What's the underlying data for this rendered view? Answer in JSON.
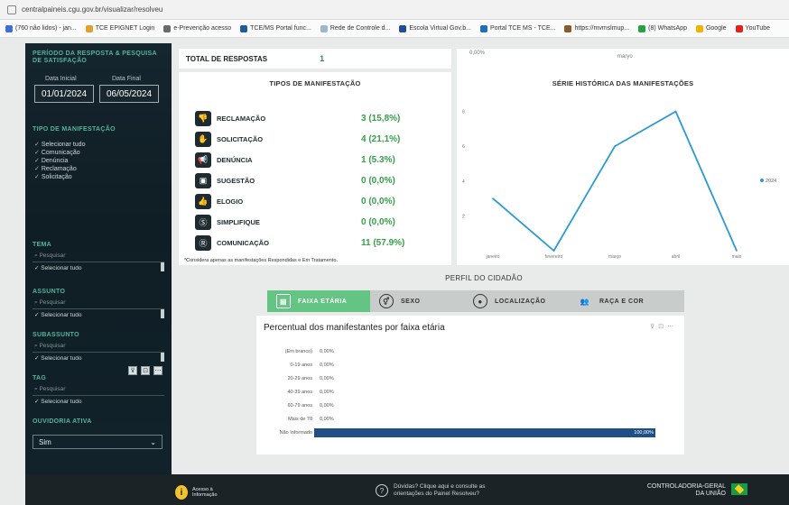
{
  "browser": {
    "url": "centralpaineis.cgu.gov.br/visualizar/resolveu",
    "bookmarks": [
      "(760 não lidos) - jan...",
      "TCE EPIGNET Login",
      "e-Prevenção acesso",
      "TCE/MS Portal func...",
      "Rede de Controle d...",
      "Escola Virtual Gov.b...",
      "Portal TCE MS - TCE...",
      "https://mvmslmup...",
      "(8) WhatsApp",
      "Google",
      "YouTube"
    ]
  },
  "sidebar": {
    "periodo_title": "PERÍODO DA RESPOSTA & PESQUISA DE SATISFAÇÃO",
    "data_inicial_label": "Data Inicial",
    "data_final_label": "Data Final",
    "data_inicial": "01/01/2024",
    "data_final": "06/05/2024",
    "tipo_title": "TIPO DE MANIFESTAÇÃO",
    "tipo_items": [
      "Selecionar tudo",
      "Comunicação",
      "Denúncia",
      "Reclamação",
      "Solicitação"
    ],
    "tema_title": "TEMA",
    "assunto_title": "ASSUNTO",
    "subassunto_title": "SUBASSUNTO",
    "tag_title": "TAG",
    "search_placeholder": "Pesquisar",
    "select_all": "Selecionar tudo",
    "ouvidoria_title": "OUVIDORIA ATIVA",
    "ouvidoria_value": "Sim"
  },
  "total": {
    "label": "TOTAL DE RESPOSTAS",
    "value": "1"
  },
  "tipos": {
    "title": "TIPOS DE MANIFESTAÇÃO",
    "rows": [
      {
        "label": "RECLAMAÇÃO",
        "value": "3 (15,8%)",
        "icon": "thumbs-down-icon"
      },
      {
        "label": "SOLICITAÇÃO",
        "value": "4 (21,1%)",
        "icon": "hand-icon"
      },
      {
        "label": "DENÚNCIA",
        "value": "1 (5.3%)",
        "icon": "megaphone-icon"
      },
      {
        "label": "SUGESTÃO",
        "value": "0 (0,0%)",
        "icon": "lightbulb-icon"
      },
      {
        "label": "ELOGIO",
        "value": "0 (0,0%)",
        "icon": "thumbs-up-icon"
      },
      {
        "label": "SIMPLIFIQUE",
        "value": "0 (0,0%)",
        "icon": "s-icon"
      },
      {
        "label": "COMUNICAÇÃO",
        "value": "11 (57.9%)",
        "icon": "comment-icon"
      }
    ],
    "note": "*Considera apenas as manifestações Respondidas e Em Tratamento."
  },
  "serie": {
    "strip_left": "0,00%",
    "strip_right": "maryo"
  },
  "chart_data": {
    "type": "line",
    "title": "SÉRIE HISTÓRICA DAS MANIFESTAÇÕES",
    "x": [
      "janeiro",
      "fevereiro",
      "março",
      "abril",
      "maio"
    ],
    "series": [
      {
        "name": "2024",
        "values": [
          3,
          0,
          6,
          8,
          0
        ]
      }
    ],
    "yticks": [
      2,
      4,
      6,
      8
    ],
    "ylim": [
      0,
      8.5
    ],
    "legend": "right",
    "color": "#2c9ad1"
  },
  "perfil": {
    "title": "PERFIL DO CIDADÃO",
    "tabs": [
      {
        "label": "FAIXA ETÁRIA",
        "icon": "calendar-icon"
      },
      {
        "label": "SEXO",
        "icon": "gender-icon"
      },
      {
        "label": "LOCALIZAÇÃO",
        "icon": "location-pin-icon"
      },
      {
        "label": "RAÇA E COR",
        "icon": "people-icon"
      }
    ]
  },
  "faixa": {
    "title": "Percentual dos manifestantes por faixa etária",
    "rows": [
      {
        "label": "(Em branco)",
        "value": "0,00%",
        "pct": 0
      },
      {
        "label": "0-19 anos",
        "value": "0,00%",
        "pct": 0
      },
      {
        "label": "20-29 anos",
        "value": "0,00%",
        "pct": 0
      },
      {
        "label": "40-39 anos",
        "value": "0,00%",
        "pct": 0
      },
      {
        "label": "60-79 anos",
        "value": "0,00%",
        "pct": 0
      },
      {
        "label": "Mais de 70",
        "value": "0,00%",
        "pct": 0
      },
      {
        "label": "Não Informado",
        "value": "100,00%",
        "pct": 1
      }
    ]
  },
  "footer": {
    "info_label": "Acesso à Informação",
    "help_text": "Dúvidas? Clique aqui e consulte as orientações do Painel Resolveu?",
    "cgu_line1": "CONTROLADORIA-GERAL",
    "cgu_line2": "DA UNIÃO"
  }
}
